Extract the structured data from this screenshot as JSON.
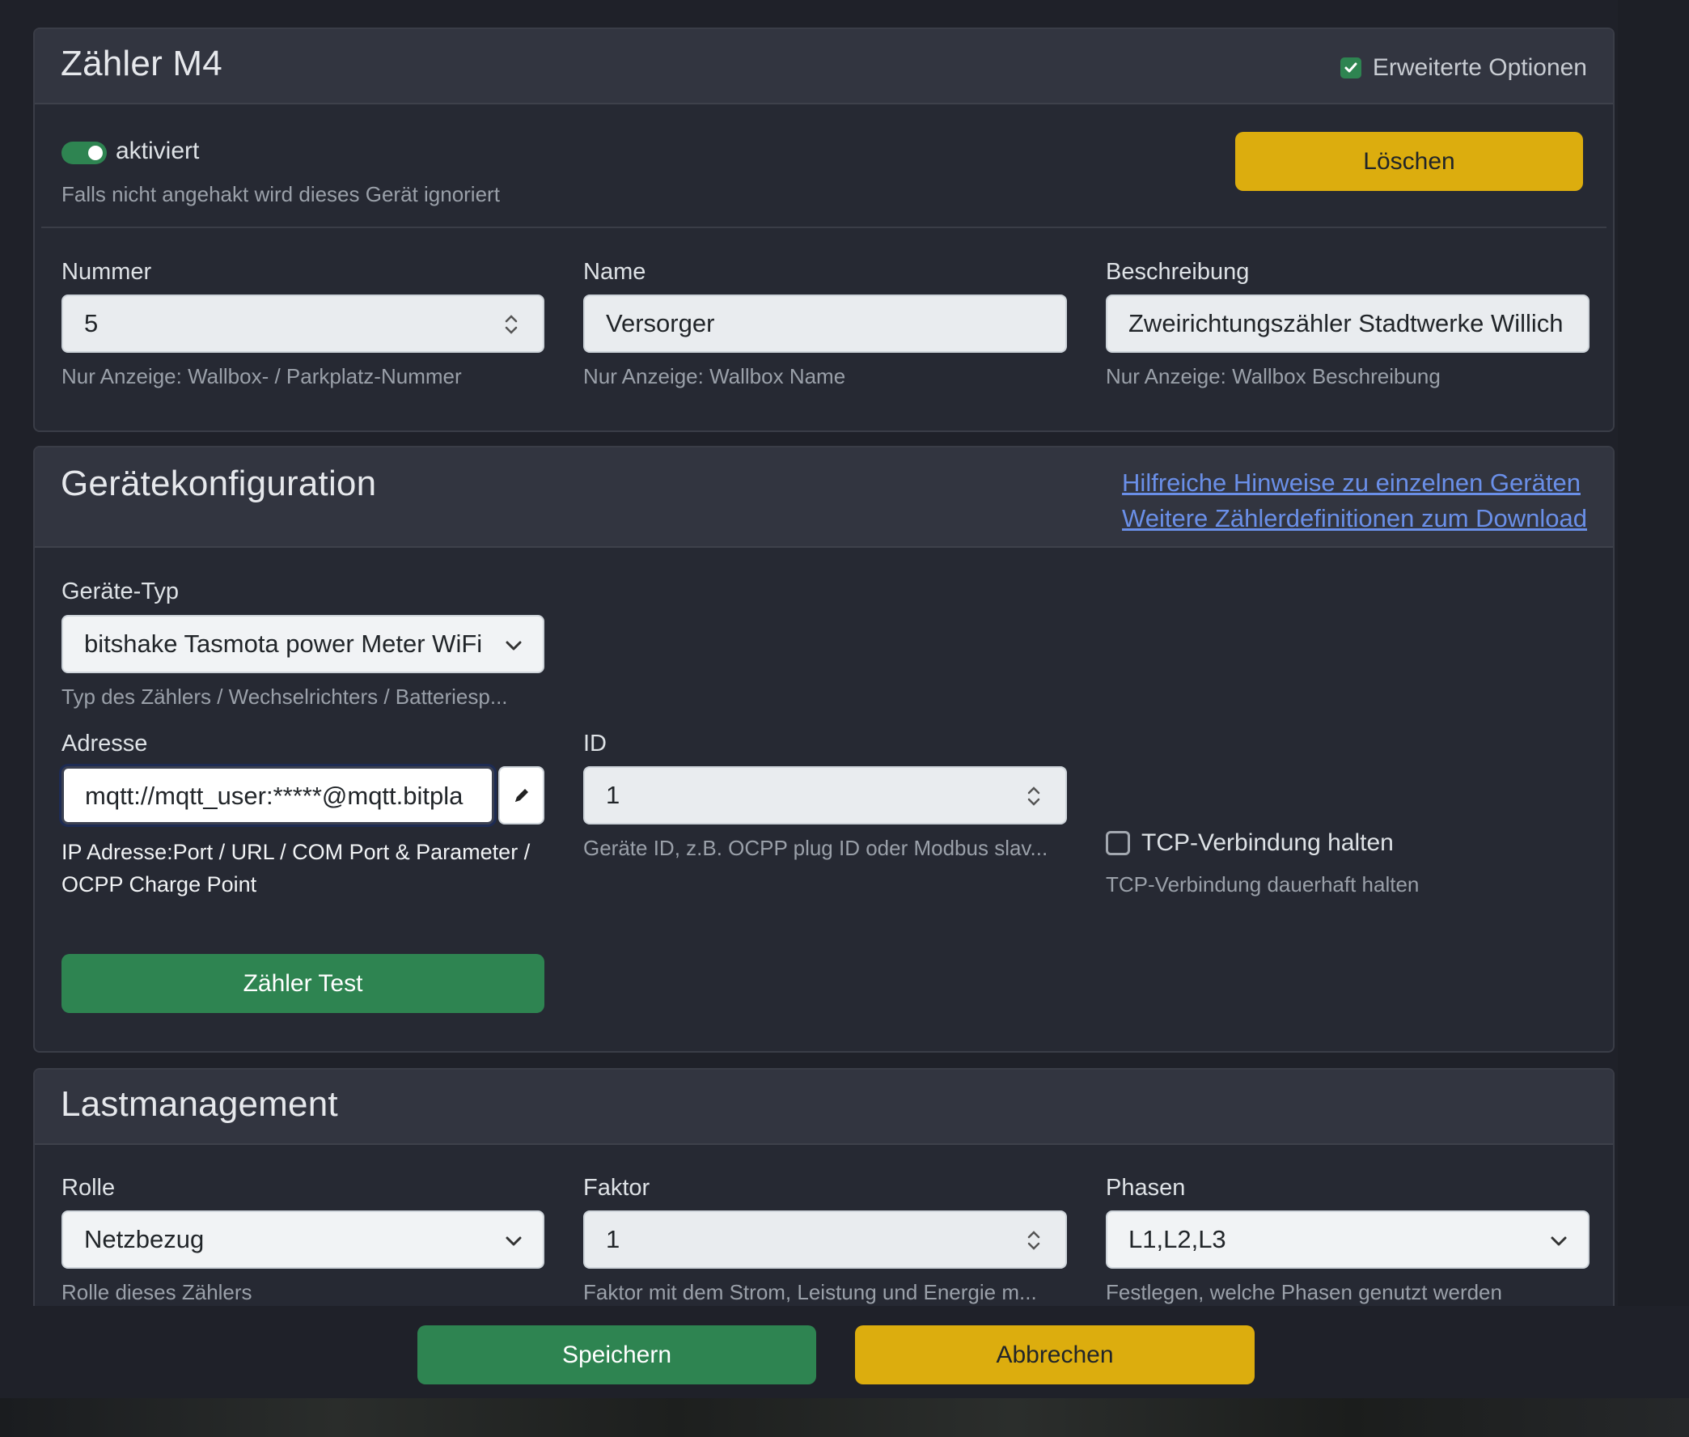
{
  "meter_card": {
    "title": "Zähler M4",
    "advanced_options": {
      "label": "Erweiterte Optionen",
      "checked": true
    },
    "activated": {
      "label": "aktiviert",
      "help": "Falls nicht angehakt wird dieses Gerät ignoriert",
      "on": true
    },
    "delete_label": "Löschen",
    "fields": {
      "number": {
        "label": "Nummer",
        "value": "5",
        "help": "Nur Anzeige: Wallbox- / Parkplatz-Nummer"
      },
      "name": {
        "label": "Name",
        "value": "Versorger",
        "help": "Nur Anzeige: Wallbox Name"
      },
      "description": {
        "label": "Beschreibung",
        "value": "Zweirichtungszähler Stadtwerke Willich",
        "help": "Nur Anzeige: Wallbox Beschreibung"
      }
    }
  },
  "device_card": {
    "title": "Gerätekonfiguration",
    "links": [
      "Hilfreiche Hinweise zu einzelnen Geräten",
      "Weitere Zählerdefinitionen zum Download"
    ],
    "device_type": {
      "label": "Geräte-Typ",
      "value": "bitshake Tasmota power Meter WiFi",
      "help": "Typ des Zählers / Wechselrichters / Batteriesp..."
    },
    "address": {
      "label": "Adresse",
      "value": "mqtt://mqtt_user:*****@mqtt.bitpla",
      "help_line1": "IP Adresse:Port / URL / COM Port & Parameter /",
      "help_line2": "OCPP Charge Point",
      "edit_icon": "pencil-icon"
    },
    "id": {
      "label": "ID",
      "value": "1",
      "help": "Geräte ID, z.B. OCPP plug ID oder Modbus slav..."
    },
    "tcp": {
      "label": "TCP-Verbindung halten",
      "help": "TCP-Verbindung dauerhaft halten",
      "checked": false
    },
    "test_label": "Zähler Test"
  },
  "load_card": {
    "title": "Lastmanagement",
    "role": {
      "label": "Rolle",
      "value": "Netzbezug",
      "help": "Rolle dieses Zählers"
    },
    "factor": {
      "label": "Faktor",
      "value": "1",
      "help": "Faktor mit dem Strom, Leistung und Energie m..."
    },
    "phases": {
      "label": "Phasen",
      "value": "L1,L2,L3",
      "help": "Festlegen, welche Phasen genutzt werden"
    }
  },
  "footer": {
    "save_label": "Speichern",
    "cancel_label": "Abbrechen"
  },
  "colors": {
    "green": "#2e8451",
    "yellow": "#dcad0e",
    "link": "#6a8fe8",
    "background": "#1f2129"
  }
}
